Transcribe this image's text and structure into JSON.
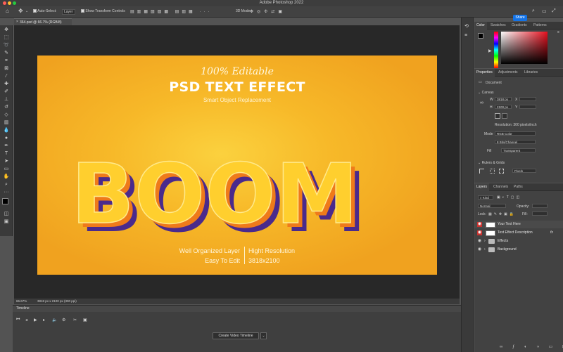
{
  "window": {
    "title": "Adobe Photoshop 2022",
    "traffic_lights": [
      "#ff5f57",
      "#febc2e",
      "#28c840"
    ]
  },
  "options_bar": {
    "auto_select_label": "Auto-Select:",
    "auto_select_value": "Layer",
    "show_transform_label": "Show Transform Controls",
    "mode_3d_label": "3D Mode:",
    "share_label": "Share",
    "accent_color": "#1473e6"
  },
  "document": {
    "tab_label": "364.psd @ 66.7% (RGB/8)",
    "zoom": "66.67%",
    "dimensions": "3818 px x 2100 px (300 ppi)"
  },
  "artwork": {
    "line1": "100% Editable",
    "line2": "PSD TEXT EFFECT",
    "line3": "Smart Object Replacement",
    "headline": "BOOM",
    "bottom_left_1": "Well Organized Layer",
    "bottom_left_2": "Easy To Edit",
    "bottom_right_1": "Hight Resolution",
    "bottom_right_2": "3818x2100",
    "colors": {
      "bg": "#f7b929",
      "letter": "#ffcf2e",
      "shadow": "#4a2a8c",
      "edge": "#ef7a1a"
    }
  },
  "timeline": {
    "title": "Timeline",
    "create_button": "Create Video Timeline"
  },
  "color_panel": {
    "tabs": [
      "Color",
      "Swatches",
      "Gradients",
      "Patterns"
    ],
    "active_tab": "Color",
    "foreground": "#000000",
    "background": "#ffffff"
  },
  "properties_panel": {
    "tabs": [
      "Properties",
      "Adjustments",
      "Libraries"
    ],
    "doc_label": "Document",
    "canvas_label": "Canvas",
    "w_label": "W",
    "w_value": "3818 px",
    "h_label": "H",
    "h_value": "2100 px",
    "x_label": "X",
    "y_label": "Y",
    "resolution": "Resolution: 300 pixels/inch",
    "mode_label": "Mode",
    "mode_value": "RGB Color",
    "depth_value": "8 Bits/Channel",
    "fill_label": "Fill",
    "fill_value": "Transparent",
    "rulers_label": "Rulers & Grids",
    "units_value": "Pixels"
  },
  "layers_panel": {
    "tabs": [
      "Layers",
      "Channels",
      "Paths"
    ],
    "filter_label": "Kind",
    "blend_label": "Normal",
    "opacity_label": "Opacity:",
    "lock_label": "Lock:",
    "fill_label": "Fill:",
    "fx_label": "fx",
    "layers": [
      {
        "name": "Your Text Here",
        "kind": "smart",
        "selected": false
      },
      {
        "name": "Text Effect Description",
        "kind": "smart",
        "selected": false
      },
      {
        "name": "Effects",
        "kind": "group",
        "selected": false
      },
      {
        "name": "Background",
        "kind": "group",
        "selected": false
      }
    ]
  }
}
